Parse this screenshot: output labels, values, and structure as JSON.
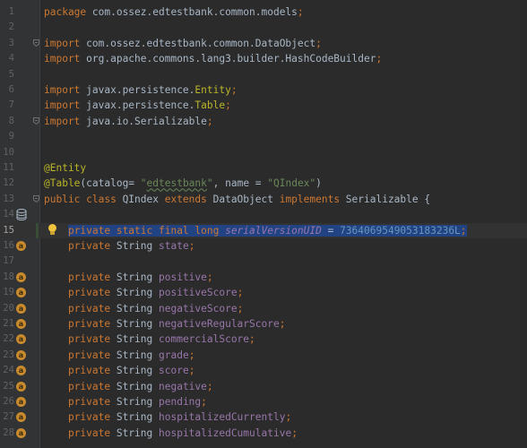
{
  "editor": {
    "language": "java",
    "current_line": "15",
    "lines": [
      {
        "n": "1",
        "segments": [
          {
            "t": "package ",
            "c": "kw"
          },
          {
            "t": "com.ossez.edtestbank.common.models",
            "c": "pkg"
          },
          {
            "t": ";",
            "c": "kw"
          }
        ]
      },
      {
        "n": "2",
        "segments": []
      },
      {
        "n": "3",
        "fold": true,
        "segments": [
          {
            "t": "import ",
            "c": "kw"
          },
          {
            "t": "com.ossez.edtestbank.common.DataObject",
            "c": "pkg"
          },
          {
            "t": ";",
            "c": "kw"
          }
        ]
      },
      {
        "n": "4",
        "segments": [
          {
            "t": "import ",
            "c": "kw"
          },
          {
            "t": "org.apache.commons.lang3.builder.HashCodeBuilder",
            "c": "pkg"
          },
          {
            "t": ";",
            "c": "kw"
          }
        ]
      },
      {
        "n": "5",
        "segments": []
      },
      {
        "n": "6",
        "segments": [
          {
            "t": "import ",
            "c": "kw"
          },
          {
            "t": "javax.persistence.",
            "c": "pkg"
          },
          {
            "t": "Entity",
            "c": "ann"
          },
          {
            "t": ";",
            "c": "kw"
          }
        ]
      },
      {
        "n": "7",
        "segments": [
          {
            "t": "import ",
            "c": "kw"
          },
          {
            "t": "javax.persistence.",
            "c": "pkg"
          },
          {
            "t": "Table",
            "c": "ann"
          },
          {
            "t": ";",
            "c": "kw"
          }
        ]
      },
      {
        "n": "8",
        "fold": true,
        "segments": [
          {
            "t": "import ",
            "c": "kw"
          },
          {
            "t": "java.io.Serializable",
            "c": "pkg"
          },
          {
            "t": ";",
            "c": "kw"
          }
        ]
      },
      {
        "n": "9",
        "segments": []
      },
      {
        "n": "10",
        "segments": []
      },
      {
        "n": "11",
        "segments": [
          {
            "t": "@Entity",
            "c": "ann"
          }
        ]
      },
      {
        "n": "12",
        "segments": [
          {
            "t": "@Table",
            "c": "ann"
          },
          {
            "t": "(catalog= ",
            "c": "pkg"
          },
          {
            "t": "\"",
            "c": "str"
          },
          {
            "t": "edtestbank",
            "c": "str u"
          },
          {
            "t": "\"",
            "c": "str"
          },
          {
            "t": ", name = ",
            "c": "pkg"
          },
          {
            "t": "\"QIndex\"",
            "c": "str"
          },
          {
            "t": ")",
            "c": "pkg"
          }
        ]
      },
      {
        "n": "13",
        "fold": true,
        "segments": [
          {
            "t": "public class ",
            "c": "kw"
          },
          {
            "t": "QIndex ",
            "c": "pkg"
          },
          {
            "t": "extends ",
            "c": "kw"
          },
          {
            "t": "DataObject ",
            "c": "pkg"
          },
          {
            "t": "implements ",
            "c": "kw"
          },
          {
            "t": "Serializable {",
            "c": "pkg"
          }
        ]
      },
      {
        "n": "14",
        "segments": []
      },
      {
        "n": "15",
        "current": true,
        "bulb": true,
        "selected": true,
        "segments": [
          {
            "t": "    ",
            "c": "pkg"
          },
          {
            "t": "private static final long ",
            "c": "kw"
          },
          {
            "t": "serialVersionUID",
            "c": "fld ital"
          },
          {
            "t": " = ",
            "c": "pkg"
          },
          {
            "t": "7364069549053183236L",
            "c": "num"
          },
          {
            "t": ";",
            "c": "kw"
          }
        ]
      },
      {
        "n": "16",
        "field": true,
        "segments": [
          {
            "t": "    ",
            "c": "pkg"
          },
          {
            "t": "private ",
            "c": "kw"
          },
          {
            "t": "String ",
            "c": "pkg"
          },
          {
            "t": "state",
            "c": "fld"
          },
          {
            "t": ";",
            "c": "kw"
          }
        ]
      },
      {
        "n": "17",
        "segments": []
      },
      {
        "n": "18",
        "field": true,
        "segments": [
          {
            "t": "    ",
            "c": "pkg"
          },
          {
            "t": "private ",
            "c": "kw"
          },
          {
            "t": "String ",
            "c": "pkg"
          },
          {
            "t": "positive",
            "c": "fld"
          },
          {
            "t": ";",
            "c": "kw"
          }
        ]
      },
      {
        "n": "19",
        "field": true,
        "segments": [
          {
            "t": "    ",
            "c": "pkg"
          },
          {
            "t": "private ",
            "c": "kw"
          },
          {
            "t": "String ",
            "c": "pkg"
          },
          {
            "t": "positiveScore",
            "c": "fld"
          },
          {
            "t": ";",
            "c": "kw"
          }
        ]
      },
      {
        "n": "20",
        "field": true,
        "segments": [
          {
            "t": "    ",
            "c": "pkg"
          },
          {
            "t": "private ",
            "c": "kw"
          },
          {
            "t": "String ",
            "c": "pkg"
          },
          {
            "t": "negativeScore",
            "c": "fld"
          },
          {
            "t": ";",
            "c": "kw"
          }
        ]
      },
      {
        "n": "21",
        "field": true,
        "segments": [
          {
            "t": "    ",
            "c": "pkg"
          },
          {
            "t": "private ",
            "c": "kw"
          },
          {
            "t": "String ",
            "c": "pkg"
          },
          {
            "t": "negativeRegularScore",
            "c": "fld"
          },
          {
            "t": ";",
            "c": "kw"
          }
        ]
      },
      {
        "n": "22",
        "field": true,
        "segments": [
          {
            "t": "    ",
            "c": "pkg"
          },
          {
            "t": "private ",
            "c": "kw"
          },
          {
            "t": "String ",
            "c": "pkg"
          },
          {
            "t": "commercialScore",
            "c": "fld"
          },
          {
            "t": ";",
            "c": "kw"
          }
        ]
      },
      {
        "n": "23",
        "field": true,
        "segments": [
          {
            "t": "    ",
            "c": "pkg"
          },
          {
            "t": "private ",
            "c": "kw"
          },
          {
            "t": "String ",
            "c": "pkg"
          },
          {
            "t": "grade",
            "c": "fld"
          },
          {
            "t": ";",
            "c": "kw"
          }
        ]
      },
      {
        "n": "24",
        "field": true,
        "segments": [
          {
            "t": "    ",
            "c": "pkg"
          },
          {
            "t": "private ",
            "c": "kw"
          },
          {
            "t": "String ",
            "c": "pkg"
          },
          {
            "t": "score",
            "c": "fld"
          },
          {
            "t": ";",
            "c": "kw"
          }
        ]
      },
      {
        "n": "25",
        "field": true,
        "segments": [
          {
            "t": "    ",
            "c": "pkg"
          },
          {
            "t": "private ",
            "c": "kw"
          },
          {
            "t": "String ",
            "c": "pkg"
          },
          {
            "t": "negative",
            "c": "fld"
          },
          {
            "t": ";",
            "c": "kw"
          }
        ]
      },
      {
        "n": "26",
        "field": true,
        "segments": [
          {
            "t": "    ",
            "c": "pkg"
          },
          {
            "t": "private ",
            "c": "kw"
          },
          {
            "t": "String ",
            "c": "pkg"
          },
          {
            "t": "pending",
            "c": "fld"
          },
          {
            "t": ";",
            "c": "kw"
          }
        ]
      },
      {
        "n": "27",
        "field": true,
        "segments": [
          {
            "t": "    ",
            "c": "pkg"
          },
          {
            "t": "private ",
            "c": "kw"
          },
          {
            "t": "String ",
            "c": "pkg"
          },
          {
            "t": "hospitalizedCurrently",
            "c": "fld"
          },
          {
            "t": ";",
            "c": "kw"
          }
        ]
      },
      {
        "n": "28",
        "field": true,
        "segments": [
          {
            "t": "    ",
            "c": "pkg"
          },
          {
            "t": "private ",
            "c": "kw"
          },
          {
            "t": "String ",
            "c": "pkg"
          },
          {
            "t": "hospitalizedCumulative",
            "c": "fld"
          },
          {
            "t": ";",
            "c": "kw"
          }
        ]
      }
    ],
    "db_icon_line": "14",
    "field_icon_letter": "a",
    "colors": {
      "background": "#2b2b2b",
      "gutter": "#313335",
      "keyword": "#cc7832",
      "annotation": "#bbb529",
      "string": "#6a8759",
      "number": "#6897bb",
      "field": "#9876aa",
      "selection": "#214283"
    }
  }
}
